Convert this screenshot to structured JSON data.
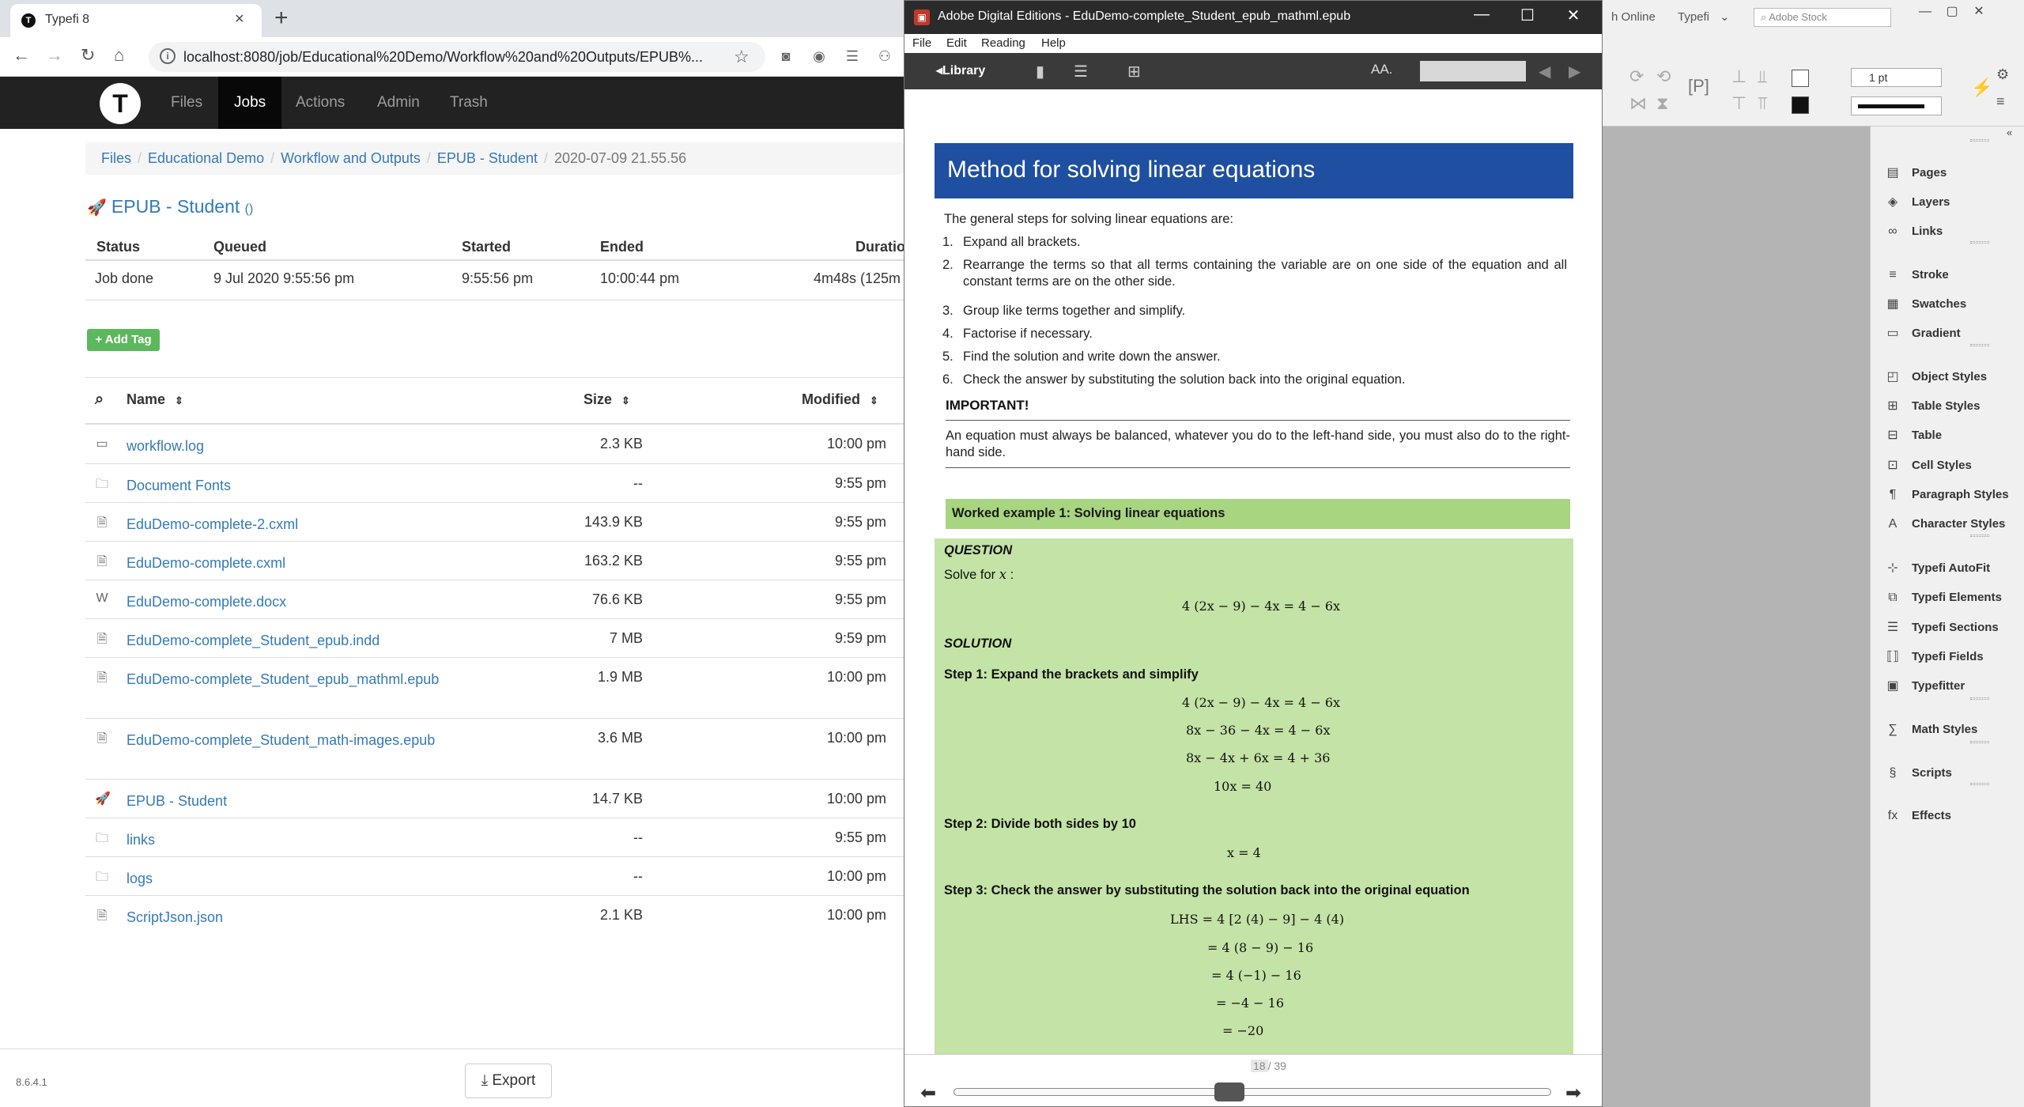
{
  "browser": {
    "tab_title": "Typefi 8",
    "tab_favicon": "T",
    "url": "localhost:8080/job/Educational%20Demo/Workflow%20and%20Outputs/EPUB%..."
  },
  "app": {
    "logo": "T",
    "nav": [
      "Files",
      "Jobs",
      "Actions",
      "Admin",
      "Trash"
    ],
    "active_nav": "Jobs",
    "breadcrumb": [
      "Files",
      "Educational Demo",
      "Workflow and Outputs",
      "EPUB - Student"
    ],
    "breadcrumb_current": "2020-07-09 21.55.56",
    "job_title": "EPUB - Student",
    "job_title_paren": "()",
    "status_headers": [
      "Status",
      "Queued",
      "Started",
      "Ended",
      "Duratio"
    ],
    "status_row": [
      "Job done",
      "9 Jul 2020 9:55:56 pm",
      "9:55:56 pm",
      "10:00:44 pm",
      "4m48s (125m"
    ],
    "add_tag_label": "+ Add Tag",
    "file_headers": {
      "name": "Name",
      "size": "Size",
      "modified": "Modified"
    },
    "files": [
      {
        "icon": "log-file-icon",
        "name": "workflow.log",
        "size": "2.3 KB",
        "modified": "10:00 pm"
      },
      {
        "icon": "folder-icon",
        "name": "Document Fonts",
        "size": "--",
        "modified": "9:55 pm"
      },
      {
        "icon": "cxml-file-icon",
        "name": "EduDemo-complete-2.cxml",
        "size": "143.9 KB",
        "modified": "9:55 pm"
      },
      {
        "icon": "cxml-file-icon",
        "name": "EduDemo-complete.cxml",
        "size": "163.2 KB",
        "modified": "9:55 pm"
      },
      {
        "icon": "word-file-icon",
        "name": "EduDemo-complete.docx",
        "size": "76.6 KB",
        "modified": "9:55 pm"
      },
      {
        "icon": "indd-file-icon",
        "name": "EduDemo-complete_Student_epub.indd",
        "size": "7 MB",
        "modified": "9:59 pm"
      },
      {
        "icon": "epub-file-icon",
        "name": "EduDemo-complete_Student_epub_mathml.epub",
        "size": "1.9 MB",
        "modified": "10:00 pm"
      },
      {
        "icon": "epub-file-icon",
        "name": "EduDemo-complete_Student_math-images.epub",
        "size": "3.6 MB",
        "modified": "10:00 pm"
      },
      {
        "icon": "rocket-icon",
        "name": "EPUB - Student",
        "size": "14.7 KB",
        "modified": "10:00 pm"
      },
      {
        "icon": "folder-icon",
        "name": "links",
        "size": "--",
        "modified": "9:55 pm"
      },
      {
        "icon": "folder-icon",
        "name": "logs",
        "size": "--",
        "modified": "10:00 pm"
      },
      {
        "icon": "script-file-icon",
        "name": "ScriptJson.json",
        "size": "2.1 KB",
        "modified": "10:00 pm"
      }
    ],
    "version": "8.6.4.1",
    "export_label": "Export"
  },
  "ade": {
    "title": "Adobe Digital Editions - EduDemo-complete_Student_epub_mathml.epub",
    "menu": [
      "File",
      "Edit",
      "Reading",
      "Help"
    ],
    "library_label": "Library",
    "font_size_label": "AA.",
    "heading": "Method for solving linear equations",
    "intro": "The general steps for solving linear equations are:",
    "steps": [
      "Expand all brackets.",
      "Rearrange the terms so that all terms containing the variable are on one side of the equation and all constant terms are on the other side.",
      "Group like terms together and simplify.",
      "Factorise if necessary.",
      "Find the solution and write down the answer.",
      "Check the answer by substituting the solution back into the original equation."
    ],
    "important_title": "IMPORTANT!",
    "important_text": "An equation must always be balanced, whatever you do to the left-hand side, you must also do to the right-hand side.",
    "worked_title": "Worked example 1: Solving linear equations",
    "question_label": "QUESTION",
    "solve_for": "Solve for",
    "solve_var": "x",
    "solve_colon": ":",
    "question_eq": "4 (2x − 9) − 4x = 4 − 6x",
    "solution_label": "SOLUTION",
    "step1": "Step 1: Expand the brackets and simplify",
    "step1_eqs": [
      "4 (2x − 9) − 4x = 4 − 6x",
      "8x − 36 − 4x = 4 − 6x",
      "8x − 4x + 6x = 4 + 36",
      "10x = 40"
    ],
    "step2": "Step 2: Divide both sides by 10",
    "step2_eq": "x = 4",
    "step3": "Step 3: Check the answer by substituting the solution back into the original equation",
    "step3_eqs": [
      "LHS  = 4 [2 (4) − 9] − 4 (4)",
      "= 4 (8 − 9) − 16",
      "= 4 (−1) − 16",
      "= −4 − 16",
      "= −20"
    ],
    "page_current": "18",
    "page_total": "/ 39",
    "reading_progress": 0.46
  },
  "indesign": {
    "toolbar_items": [
      "h Online",
      "Typefi",
      "Adobe Stock"
    ],
    "stroke_weight": "1 pt",
    "panels": [
      {
        "label": "Pages",
        "icon": "pages-icon"
      },
      {
        "label": "Layers",
        "icon": "layers-icon"
      },
      {
        "label": "Links",
        "icon": "links-icon"
      },
      {
        "label": "Stroke",
        "icon": "stroke-icon"
      },
      {
        "label": "Swatches",
        "icon": "swatches-icon"
      },
      {
        "label": "Gradient",
        "icon": "gradient-icon"
      },
      {
        "label": "Object Styles",
        "icon": "object-styles-icon"
      },
      {
        "label": "Table Styles",
        "icon": "table-styles-icon"
      },
      {
        "label": "Table",
        "icon": "table-icon"
      },
      {
        "label": "Cell Styles",
        "icon": "cell-styles-icon"
      },
      {
        "label": "Paragraph Styles",
        "icon": "paragraph-styles-icon"
      },
      {
        "label": "Character Styles",
        "icon": "character-styles-icon"
      },
      {
        "label": "Typefi AutoFit",
        "icon": "autofit-icon"
      },
      {
        "label": "Typefi Elements",
        "icon": "elements-icon"
      },
      {
        "label": "Typefi Sections",
        "icon": "sections-icon"
      },
      {
        "label": "Typefi Fields",
        "icon": "fields-icon"
      },
      {
        "label": "Typefitter",
        "icon": "typefitter-icon"
      },
      {
        "label": "Math Styles",
        "icon": "math-styles-icon"
      },
      {
        "label": "Scripts",
        "icon": "scripts-icon"
      },
      {
        "label": "Effects",
        "icon": "effects-icon"
      }
    ]
  }
}
